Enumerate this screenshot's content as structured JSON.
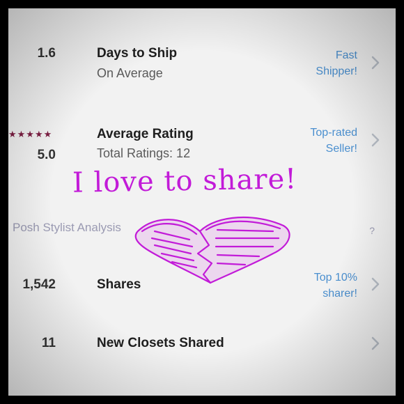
{
  "rows": [
    {
      "metric": "1.6",
      "title": "Days to Ship",
      "subtitle": "On Average",
      "badge_line1": "Fast",
      "badge_line2": "Shipper!"
    },
    {
      "metric": "5.0",
      "title": "Average Rating",
      "subtitle": "Total Ratings: 12",
      "badge_line1": "Top-rated",
      "badge_line2": "Seller!",
      "stars": "★★★★★"
    },
    {
      "metric": "1,542",
      "title": "Shares",
      "subtitle": "",
      "badge_line1": "Top 10%",
      "badge_line2": "sharer!"
    },
    {
      "metric": "11",
      "title": "New Closets Shared",
      "subtitle": "",
      "badge_line1": "",
      "badge_line2": ""
    }
  ],
  "section": {
    "label": "Posh Stylist Analysis",
    "help": "?"
  },
  "overlay": {
    "text": "I love to share!",
    "color": "#c21bd8"
  },
  "colors": {
    "badge": "#4a8fcf",
    "stars": "#7c1d42",
    "background": "#f2f2f2"
  },
  "icons": {
    "chevron": "chevron-right-icon",
    "heart": "broken-heart-icon",
    "help": "help-icon"
  }
}
